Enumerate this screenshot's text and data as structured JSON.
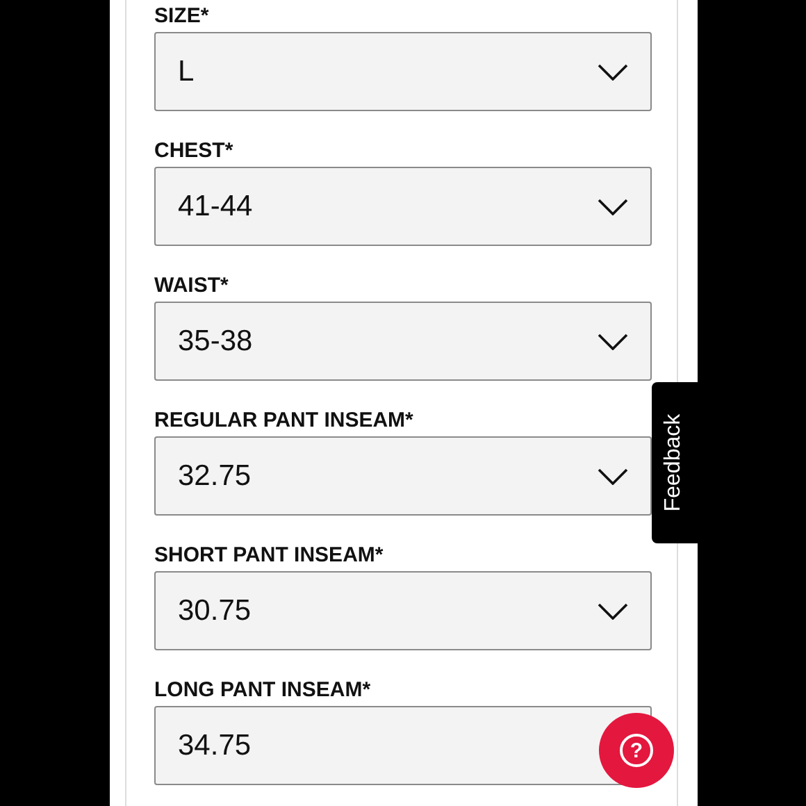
{
  "fields": [
    {
      "label": "SIZE*",
      "value": "L",
      "chevron_visible": true
    },
    {
      "label": "CHEST*",
      "value": "41-44",
      "chevron_visible": true
    },
    {
      "label": "WAIST*",
      "value": "35-38",
      "chevron_visible": true
    },
    {
      "label": "REGULAR PANT INSEAM*",
      "value": "32.75",
      "chevron_visible": true
    },
    {
      "label": "SHORT PANT INSEAM*",
      "value": "30.75",
      "chevron_visible": true
    },
    {
      "label": "LONG PANT INSEAM*",
      "value": "34.75",
      "chevron_visible": false
    }
  ],
  "feedback_tab": {
    "label": "Feedback"
  },
  "help_button": {
    "label": "?"
  }
}
